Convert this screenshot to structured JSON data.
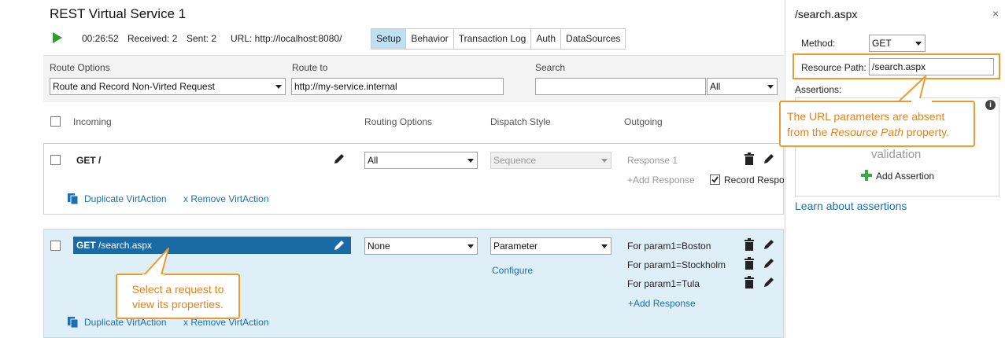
{
  "service": {
    "title": "REST Virtual Service 1",
    "time": "00:26:52",
    "received": "Received: 2",
    "sent": "Sent: 2",
    "url": "URL: http://localhost:8080/"
  },
  "tabs": [
    {
      "label": "Setup"
    },
    {
      "label": "Behavior"
    },
    {
      "label": "Transaction Log"
    },
    {
      "label": "Auth"
    },
    {
      "label": "DataSources"
    }
  ],
  "options": {
    "route_options_label": "Route Options",
    "route_options_value": "Route and Record Non-Virted Request",
    "route_to_label": "Route to",
    "route_to_value": "http://my-service.internal",
    "search_label": "Search",
    "search_value": "",
    "search_filter": "All"
  },
  "columns": {
    "incoming": "Incoming",
    "routing": "Routing Options",
    "dispatch": "Dispatch Style",
    "outgoing": "Outgoing"
  },
  "actions": [
    {
      "method": "GET",
      "path": "/",
      "routing": "All",
      "dispatch": "Sequence",
      "responses": [
        "Response 1"
      ],
      "add_response": "+Add Response",
      "record_response": "Record Respor",
      "duplicate": "Duplicate VirtAction",
      "remove": "x Remove VirtAction"
    },
    {
      "method": "GET",
      "path": "/search.aspx",
      "routing": "None",
      "dispatch": "Parameter",
      "configure": "Configure",
      "responses": [
        "For param1=Boston",
        "For param1=Stockholm",
        "For param1=Tula"
      ],
      "add_response": "+Add Response",
      "duplicate": "Duplicate VirtAction",
      "remove": "x Remove VirtAction"
    }
  ],
  "callout_left": {
    "line1": "Select a request to",
    "line2": "view its properties."
  },
  "panel": {
    "title": "/search.aspx",
    "close": "×",
    "method_label": "Method:",
    "method_value": "GET",
    "resource_label": "Resource Path:",
    "resource_value": "/search.aspx",
    "assertions_label": "Assertions:",
    "validation_text": "validation",
    "add_assertion": "Add Assertion",
    "learn_link": "Learn about assertions"
  },
  "callout_right": {
    "line1": "The URL parameters are absent",
    "line2_prefix": "from the ",
    "line2_em": "Resource Path",
    "line2_suffix": " property."
  },
  "colors": {
    "accent": "#1a6aa6",
    "selected_tab": "#bfe0f3",
    "callout": "#f0992f",
    "play": "#2e9e2e"
  }
}
